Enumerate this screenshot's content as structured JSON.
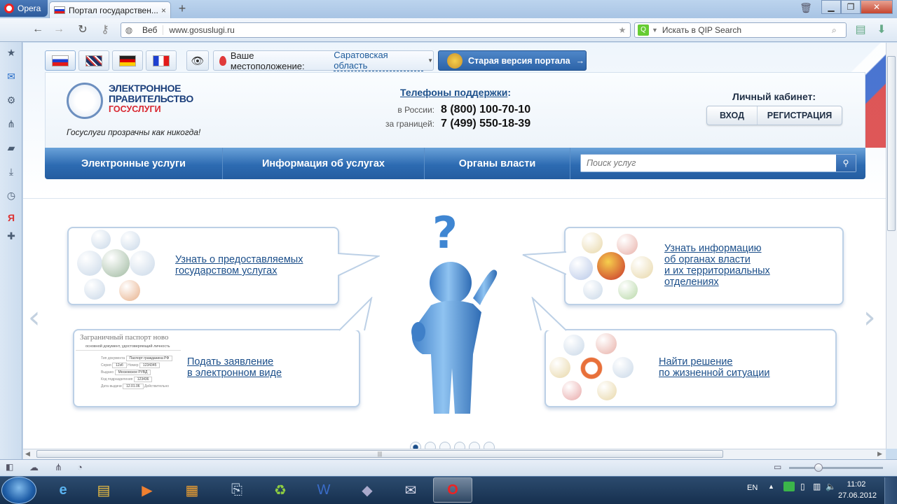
{
  "browser": {
    "menu_label": "Opera",
    "tab_title": "Портал государствен...",
    "tab_close": "×",
    "new_tab": "+",
    "address_prefix": "Веб",
    "url": "www.gosuslugi.ru",
    "search_placeholder": "Искать в QIP Search",
    "sidebar_icons": [
      "star-icon",
      "mail-icon",
      "gear-icon",
      "share-icon",
      "note-icon",
      "download-icon",
      "clock-icon",
      "yandex-icon",
      "plus-icon"
    ]
  },
  "site": {
    "langs": [
      "ru",
      "en",
      "de",
      "fr"
    ],
    "location_label": "Ваше местоположение:",
    "location_value": "Саратовская область",
    "old_version": "Старая версия портала",
    "logo_line1": "ЭЛЕКТРОННОЕ",
    "logo_line2": "ПРАВИТЕЛЬСТВО",
    "logo_line3": "ГОСУСЛУГИ",
    "slogan": "Госуслуги прозрачны как никогда!",
    "phones_title": "Телефоны поддержки",
    "phones_colon": ":",
    "phones": [
      {
        "label": "в России:",
        "number": "8 (800) 100-70-10"
      },
      {
        "label": "за границей:",
        "number": "7 (499) 550-18-39"
      }
    ],
    "cabinet_title": "Личный кабинет:",
    "login": "ВХОД",
    "register": "РЕГИСТРАЦИЯ",
    "nav": [
      "Электронные услуги",
      "Информация об услугах",
      "Органы власти"
    ],
    "search_placeholder": "Поиск услуг"
  },
  "content": {
    "bubbles": {
      "top_left": [
        "Узнать о предоставляемых",
        "государством услугах"
      ],
      "bottom_left": [
        "Подать заявление",
        "в электронном виде"
      ],
      "top_right": [
        "Узнать информацию",
        "об органах власти",
        "и их территориальных",
        "отделениях"
      ],
      "bottom_right": [
        "Найти решение",
        "по жизненной ситуации"
      ]
    },
    "form_preview": {
      "title": "Заграничный паспорт ново",
      "subtitle": "основной документ, удостоверяющий личность",
      "rows": [
        {
          "label": "Тип документа",
          "value": "Паспорт гражданина РФ"
        },
        {
          "label": "Серия",
          "value": "12зб"
        },
        {
          "label": "Номер",
          "value": "1234345"
        },
        {
          "label": "Выдано",
          "value": "Московское РУВД"
        },
        {
          "label": "Код подразделения",
          "value": "123436"
        },
        {
          "label": "Дата выдачи",
          "value": "12.01.06"
        },
        {
          "label": "Действительно",
          "value": ""
        }
      ]
    },
    "slides_count": 6,
    "active_slide": 1,
    "prev_arrow": "‹",
    "next_arrow": "›"
  },
  "taskbar": {
    "lang": "EN",
    "time": "11:02",
    "date": "27.06.2012"
  }
}
